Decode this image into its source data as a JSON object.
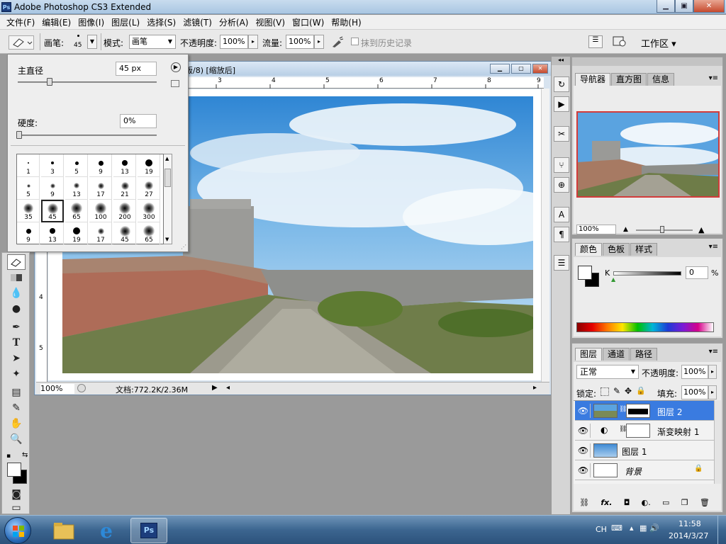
{
  "app": {
    "title": "Adobe Photoshop CS3 Extended",
    "badge": "Ps",
    "win_minimize": "▁",
    "win_restore": "▣",
    "win_close": "✕"
  },
  "menu": [
    "文件(F)",
    "编辑(E)",
    "图像(I)",
    "图层(L)",
    "选择(S)",
    "滤镜(T)",
    "分析(A)",
    "视图(V)",
    "窗口(W)",
    "帮助(H)"
  ],
  "options": {
    "brush_label": "画笔:",
    "brush_size": "45",
    "mode_label": "模式:",
    "mode_value": "画笔",
    "opacity_label": "不透明度:",
    "opacity_value": "100%",
    "flow_label": "流量:",
    "flow_value": "100%",
    "history_label": "抹到历史记录",
    "workspace_label": "工作区 ▾"
  },
  "brush_picker": {
    "diameter_label": "主直径",
    "diameter_value": "45 px",
    "hardness_label": "硬度:",
    "hardness_value": "0%",
    "presets": [
      {
        "size": "1",
        "hard": true
      },
      {
        "size": "3",
        "hard": true
      },
      {
        "size": "5",
        "hard": true
      },
      {
        "size": "9",
        "hard": true
      },
      {
        "size": "13",
        "hard": true
      },
      {
        "size": "19",
        "hard": true
      },
      {
        "size": "5",
        "hard": false
      },
      {
        "size": "9",
        "hard": false
      },
      {
        "size": "13",
        "hard": false
      },
      {
        "size": "17",
        "hard": false
      },
      {
        "size": "21",
        "hard": false
      },
      {
        "size": "27",
        "hard": false
      },
      {
        "size": "35",
        "hard": false
      },
      {
        "size": "45",
        "hard": false
      },
      {
        "size": "65",
        "hard": false
      },
      {
        "size": "100",
        "hard": false
      },
      {
        "size": "200",
        "hard": false
      },
      {
        "size": "300",
        "hard": false
      },
      {
        "size": "9",
        "hard": true
      },
      {
        "size": "13",
        "hard": true
      },
      {
        "size": "19",
        "hard": true
      },
      {
        "size": "17",
        "hard": false
      },
      {
        "size": "45",
        "hard": false
      },
      {
        "size": "65",
        "hard": false
      }
    ],
    "selected_index": 13
  },
  "document": {
    "title": "版/8) [缩放后]",
    "zoom": "100%",
    "doc_info": "文档:772.2K/2.36M",
    "ruler_top": [
      "3",
      "4",
      "5",
      "6",
      "7",
      "8",
      "9"
    ],
    "ruler_left": [
      "4",
      "5"
    ]
  },
  "navigator": {
    "tabs": [
      "导航器",
      "直方图",
      "信息"
    ],
    "zoom": "100%"
  },
  "color": {
    "tabs": [
      "颜色",
      "色板",
      "样式"
    ],
    "channel": "K",
    "value": "0",
    "unit": "%"
  },
  "layers": {
    "tabs": [
      "图层",
      "通道",
      "路径"
    ],
    "blend_mode": "正常",
    "opacity_label": "不透明度:",
    "opacity_value": "100%",
    "lock_label": "锁定:",
    "fill_label": "填充:",
    "fill_value": "100%",
    "items": [
      {
        "name": "图层 2",
        "selected": true
      },
      {
        "name": "渐变映射 1",
        "selected": false
      },
      {
        "name": "图层 1",
        "selected": false
      },
      {
        "name": "背景",
        "selected": false
      }
    ]
  },
  "taskbar": {
    "items": [
      "explorer-folder",
      "internet-explorer",
      "photoshop"
    ],
    "ps_label": "Ps",
    "lang": "CH",
    "time": "11:58",
    "date": "2014/3/27"
  }
}
